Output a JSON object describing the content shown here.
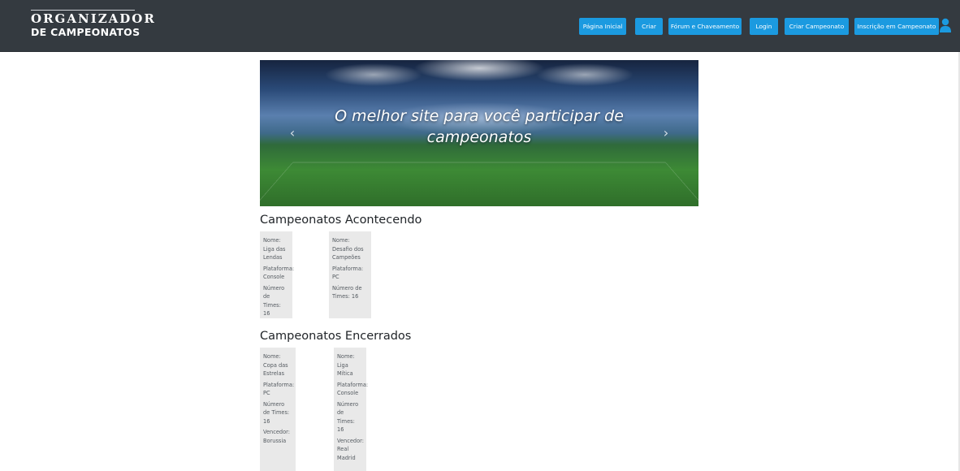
{
  "brand": {
    "line1": "ORGANIZADOR",
    "line2": "DE CAMPEONATOS"
  },
  "nav": {
    "buttons": [
      "Página Inicial",
      "Criar",
      "Fórum e Chaveamento",
      "Login",
      "Criar Campeonato",
      "Inscrição em Campeonato"
    ],
    "user_icon": "user-icon"
  },
  "carousel": {
    "caption": "O melhor site para você participar de campeonatos",
    "prev_icon": "chevron-left-icon",
    "next_icon": "chevron-right-icon"
  },
  "ongoing": {
    "title": "Campeonatos Acontecendo",
    "cards": [
      {
        "name": "Nome: Liga das Lendas",
        "platform": "Plataforma: Console",
        "teams": "Número de Times: 16"
      },
      {
        "name": "Nome: Desafio dos Campeões",
        "platform": "Plataforma: PC",
        "teams": "Número de Times: 16"
      }
    ]
  },
  "ended": {
    "title": "Campeonatos Encerrados",
    "cards": [
      {
        "name": "Nome: Copa das Estrelas",
        "platform": "Plataforma: PC",
        "teams": "Número de Times: 16",
        "winner": "Vencedor: Borussia"
      },
      {
        "name": "Nome: Liga Mítica",
        "platform": "Plataforma: Console",
        "teams": "Número de Times: 16",
        "winner": "Vencedor: Real Madrid"
      }
    ]
  },
  "colors": {
    "navbar": "#343a40",
    "button": "#1b9ae0",
    "card": "#e9e9e9"
  }
}
